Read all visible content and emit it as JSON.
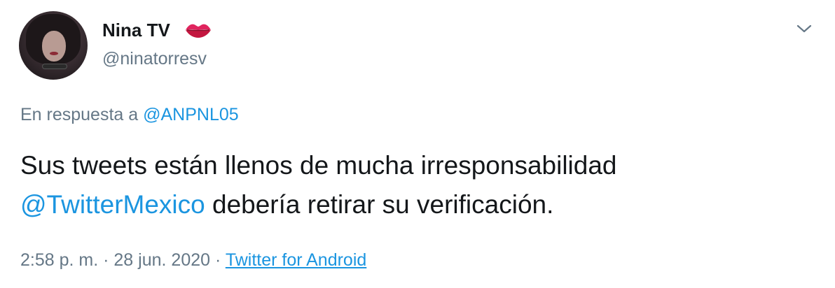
{
  "author": {
    "display_name": "Nina TV",
    "handle": "@ninatorresv",
    "name_emoji": "lips-kiss-icon"
  },
  "reply": {
    "prefix": "En respuesta a",
    "mention": "@ANPNL05"
  },
  "tweet": {
    "line1": "Sus tweets están llenos de mucha irresponsabilidad",
    "mention": "@TwitterMexico",
    "line2_rest": "debería retirar su verificación."
  },
  "meta": {
    "time": "2:58 p. m.",
    "separator1": "·",
    "date": "28 jun. 2020",
    "separator2": "·",
    "source": "Twitter for Android"
  },
  "colors": {
    "link": "#1b95e0",
    "muted": "#657786",
    "text": "#14171a"
  }
}
